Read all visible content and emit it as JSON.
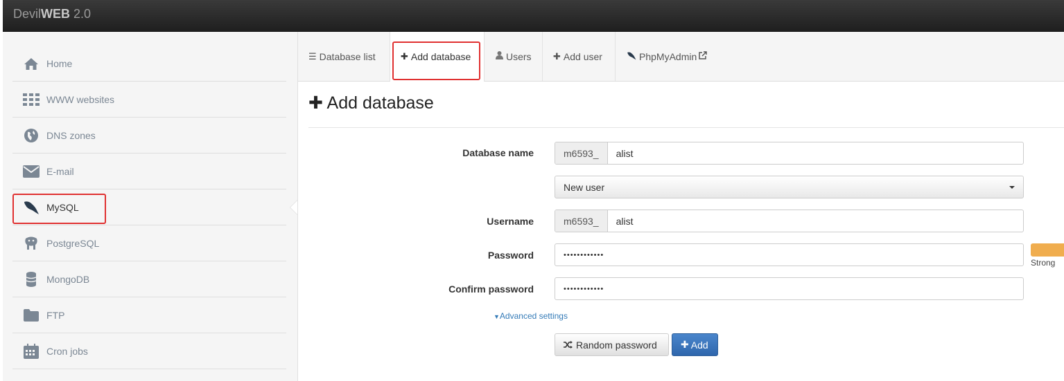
{
  "app": {
    "brand_prefix": "Devil",
    "brand_bold": "WEB",
    "brand_version": "2.0"
  },
  "sidebar": {
    "items": [
      {
        "label": "Home",
        "icon": "home-icon"
      },
      {
        "label": "WWW websites",
        "icon": "grid-icon"
      },
      {
        "label": "DNS zones",
        "icon": "globe-icon"
      },
      {
        "label": "E-mail",
        "icon": "envelope-icon"
      },
      {
        "label": "MySQL",
        "icon": "mysql-dolphin-icon"
      },
      {
        "label": "PostgreSQL",
        "icon": "postgresql-elephant-icon"
      },
      {
        "label": "MongoDB",
        "icon": "database-icon"
      },
      {
        "label": "FTP",
        "icon": "folder-icon"
      },
      {
        "label": "Cron jobs",
        "icon": "calendar-icon"
      }
    ],
    "active": "MySQL"
  },
  "tabs": [
    {
      "label": "Database list",
      "icon": "list-icon"
    },
    {
      "label": "Add database",
      "icon": "plus-icon"
    },
    {
      "label": "Users",
      "icon": "user-icon"
    },
    {
      "label": "Add user",
      "icon": "plus-icon"
    },
    {
      "label": "PhpMyAdmin",
      "icon": "mysql-dolphin-icon"
    }
  ],
  "page": {
    "title": "Add database"
  },
  "form": {
    "db_name_label": "Database name",
    "db_prefix": "m6593_",
    "db_name_value": "alist",
    "user_select_value": "New user",
    "username_label": "Username",
    "username_prefix": "m6593_",
    "username_value": "alist",
    "password_label": "Password",
    "password_mask": "••••••••••••",
    "confirm_label": "Confirm password",
    "confirm_mask": "••••••••••••",
    "strength_label": "Strong",
    "advanced_label": "Advanced settings",
    "random_btn": "Random password",
    "add_btn": "Add"
  },
  "colors": {
    "highlight": "#e03030",
    "accent": "#337ab7",
    "strength": "#f0ad4e"
  }
}
